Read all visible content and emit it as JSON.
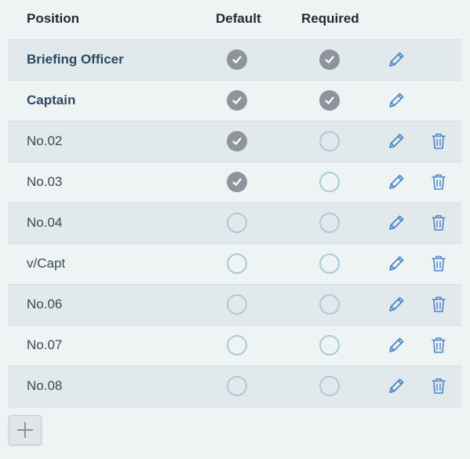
{
  "header": {
    "position": "Position",
    "default": "Default",
    "required": "Required"
  },
  "rows": [
    {
      "position": "Briefing Officer",
      "bold": true,
      "default": true,
      "required": true,
      "deletable": false
    },
    {
      "position": "Captain",
      "bold": true,
      "default": true,
      "required": true,
      "deletable": false
    },
    {
      "position": "No.02",
      "bold": false,
      "default": true,
      "required": false,
      "deletable": true
    },
    {
      "position": "No.03",
      "bold": false,
      "default": true,
      "required": false,
      "deletable": true
    },
    {
      "position": "No.04",
      "bold": false,
      "default": false,
      "required": false,
      "deletable": true
    },
    {
      "position": "v/Capt",
      "bold": false,
      "default": false,
      "required": false,
      "deletable": true
    },
    {
      "position": "No.06",
      "bold": false,
      "default": false,
      "required": false,
      "deletable": true
    },
    {
      "position": "No.07",
      "bold": false,
      "default": false,
      "required": false,
      "deletable": true
    },
    {
      "position": "No.08",
      "bold": false,
      "default": false,
      "required": false,
      "deletable": true
    }
  ],
  "icons": {
    "edit": "pencil-icon",
    "delete": "trash-icon",
    "add": "plus-icon",
    "check": "check-icon"
  },
  "colors": {
    "checked_fill": "#8d949b",
    "unchecked_ring": "#a9ccd8",
    "icon_blue": "#4d86c4",
    "row_odd": "#e1e9ec",
    "row_even": "#eef3f4"
  }
}
